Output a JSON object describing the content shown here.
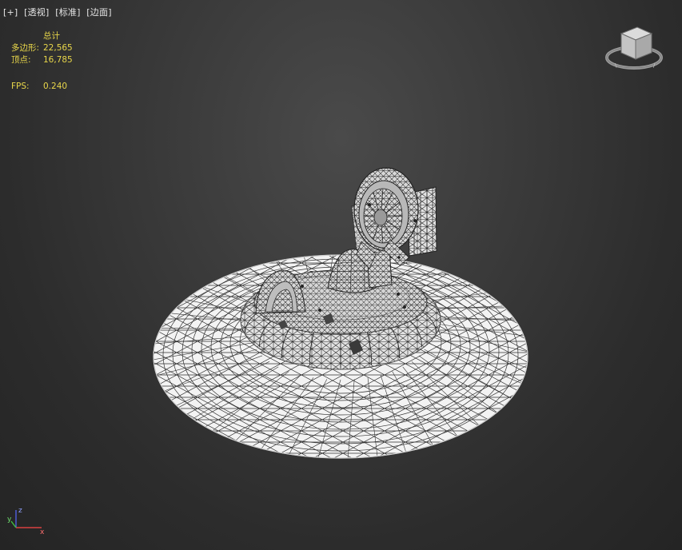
{
  "viewport": {
    "labels": [
      "[+]",
      "[透视]",
      "[标准]",
      "[边面]"
    ]
  },
  "stats": {
    "header": "总计",
    "polys_label": "多边形:",
    "polys_value": "22,565",
    "verts_label": "顶点:",
    "verts_value": "16,785",
    "fps_label": "FPS:",
    "fps_value": "0.240"
  },
  "axis": {
    "z": "z",
    "y": "y",
    "x": "x"
  },
  "colors": {
    "stats_text": "#e8d64a",
    "wire": "#2b2b2b",
    "mesh": "#f2f2f2",
    "axis_x": "#d84040",
    "axis_y": "#40c040",
    "axis_z": "#5060e0"
  }
}
